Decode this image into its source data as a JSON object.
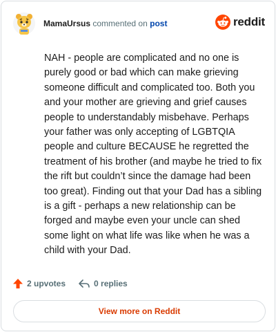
{
  "header": {
    "username": "MamaUrsus",
    "action_text": "commented on",
    "post_link": "post"
  },
  "brand": {
    "name": "reddit",
    "icon": "reddit-logo-icon"
  },
  "comment": {
    "body": "NAH - people are complicated and no one is purely good or bad which can make grieving someone difficult and complicated too. Both you and your mother are grieving and grief causes people to understandably misbehave. Perhaps your father was only accepting of LGBTQIA people and culture BECAUSE he regretted the treatment of his brother (and maybe he tried to fix the rift but couldn’t since the damage had been too great). Finding out that your Dad has a sibling is a gift - perhaps a new relationship can be forged and maybe even your uncle can shed some light on what life was like when he was a child with your Dad."
  },
  "actions": {
    "upvotes_label": "2 upvotes",
    "replies_label": "0 replies"
  },
  "footer": {
    "view_more_label": "View more on Reddit"
  },
  "colors": {
    "accent": "#d93a00",
    "upvote": "#ff4500",
    "link": "#0045ac",
    "border": "#d9dde1"
  }
}
